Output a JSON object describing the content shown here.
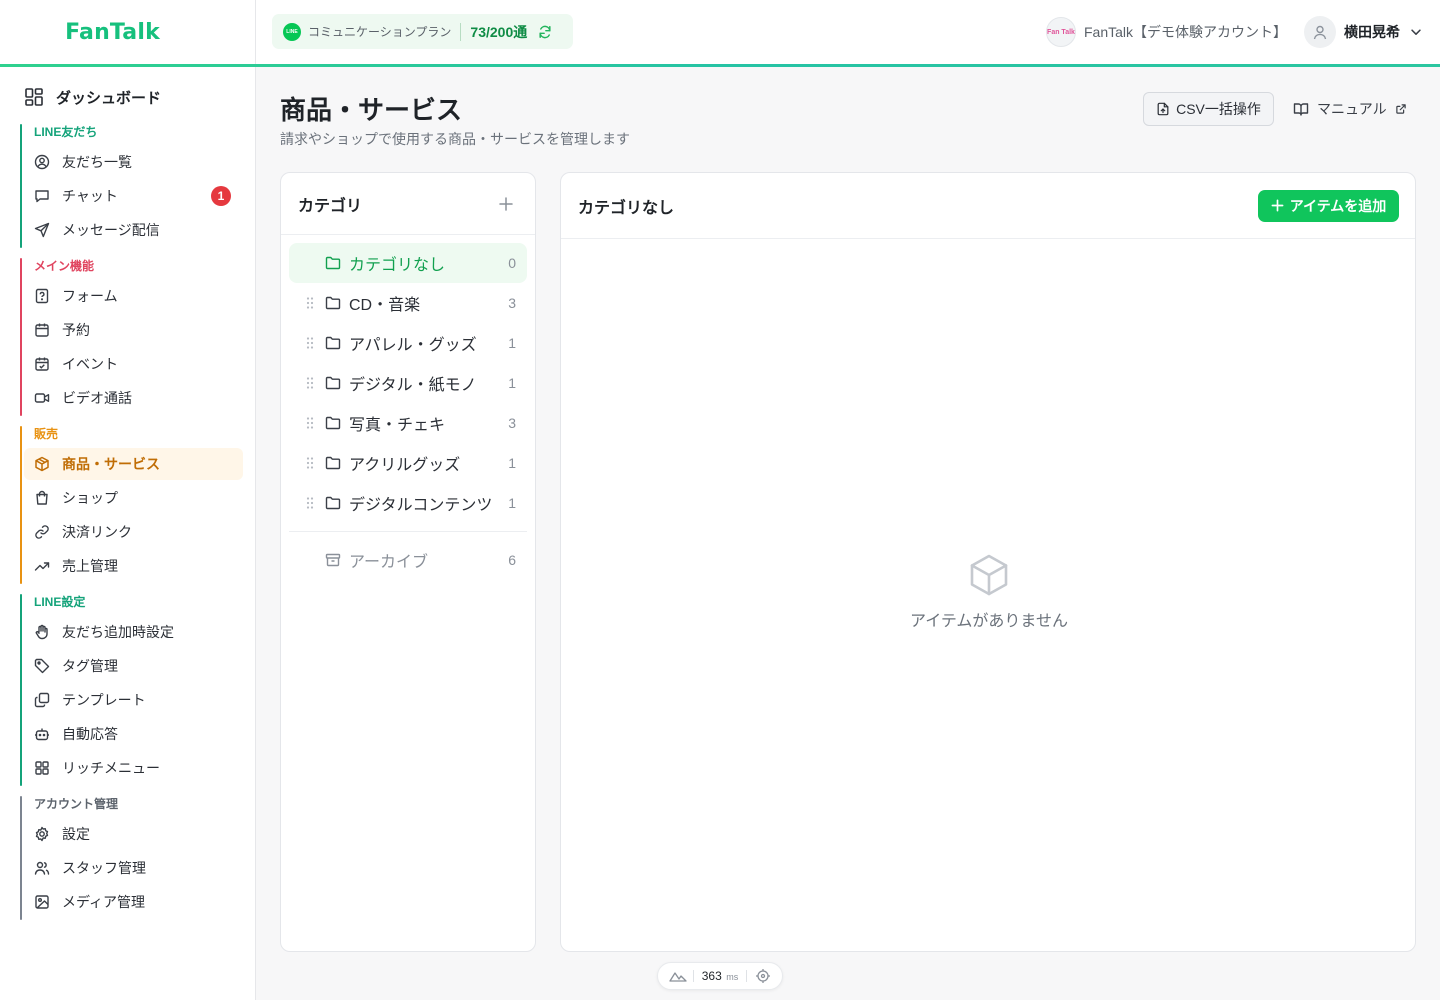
{
  "app": {
    "logo": "FanTalk"
  },
  "header": {
    "plan_label": "コミュニケーションプラン",
    "plan_count": "73/200通",
    "account_avatar_text": "Fan Talk",
    "account_name": "FanTalk【デモ体験アカウント】",
    "user_name": "横田晃希"
  },
  "sidebar": {
    "dashboard": "ダッシュボード",
    "groups": [
      {
        "title": "LINE友だち",
        "color": "#14a37a",
        "items": [
          {
            "label": "友だち一覧",
            "icon": "user-circle-icon"
          },
          {
            "label": "チャット",
            "icon": "chat-icon",
            "badge": "1"
          },
          {
            "label": "メッセージ配信",
            "icon": "send-icon"
          }
        ]
      },
      {
        "title": "メイン機能",
        "color": "#e0445f",
        "items": [
          {
            "label": "フォーム",
            "icon": "form-icon"
          },
          {
            "label": "予約",
            "icon": "calendar-icon"
          },
          {
            "label": "イベント",
            "icon": "calendar-check-icon"
          },
          {
            "label": "ビデオ通話",
            "icon": "video-icon"
          }
        ]
      },
      {
        "title": "販売",
        "color": "#e89212",
        "items": [
          {
            "label": "商品・サービス",
            "icon": "package-icon",
            "active": true
          },
          {
            "label": "ショップ",
            "icon": "shopping-bag-icon"
          },
          {
            "label": "決済リンク",
            "icon": "link-icon"
          },
          {
            "label": "売上管理",
            "icon": "trending-up-icon"
          }
        ]
      },
      {
        "title": "LINE設定",
        "color": "#14a37a",
        "items": [
          {
            "label": "友だち追加時設定",
            "icon": "hand-icon"
          },
          {
            "label": "タグ管理",
            "icon": "tag-icon"
          },
          {
            "label": "テンプレート",
            "icon": "copy-icon"
          },
          {
            "label": "自動応答",
            "icon": "bot-icon"
          },
          {
            "label": "リッチメニュー",
            "icon": "grid-icon"
          }
        ]
      },
      {
        "title": "アカウント管理",
        "color": "#7c8490",
        "items": [
          {
            "label": "設定",
            "icon": "gear-icon"
          },
          {
            "label": "スタッフ管理",
            "icon": "users-icon"
          },
          {
            "label": "メディア管理",
            "icon": "image-icon"
          }
        ]
      }
    ]
  },
  "page": {
    "title": "商品・サービス",
    "subtitle": "請求やショップで使用する商品・サービスを管理します",
    "csv_button": "CSV一括操作",
    "manual_link": "マニュアル"
  },
  "categories": {
    "title": "カテゴリ",
    "rows": [
      {
        "label": "カテゴリなし",
        "count": "0",
        "active": true,
        "draggable": false
      },
      {
        "label": "CD・音楽",
        "count": "3",
        "draggable": true
      },
      {
        "label": "アパレル・グッズ",
        "count": "1",
        "draggable": true
      },
      {
        "label": "デジタル・紙モノ",
        "count": "1",
        "draggable": true
      },
      {
        "label": "写真・チェキ",
        "count": "3",
        "draggable": true
      },
      {
        "label": "アクリルグッズ",
        "count": "1",
        "draggable": true
      },
      {
        "label": "デジタルコンテンツ",
        "count": "1",
        "draggable": true
      }
    ],
    "archive": {
      "label": "アーカイブ",
      "count": "6"
    }
  },
  "items": {
    "title": "カテゴリなし",
    "add_button": "アイテムを追加",
    "empty_message": "アイテムがありません"
  },
  "perf": {
    "value": "363",
    "unit": "ms"
  },
  "colors": {
    "brand": "#16c07d",
    "primary_button": "#10c55c",
    "active_sales": "#c06d05"
  }
}
